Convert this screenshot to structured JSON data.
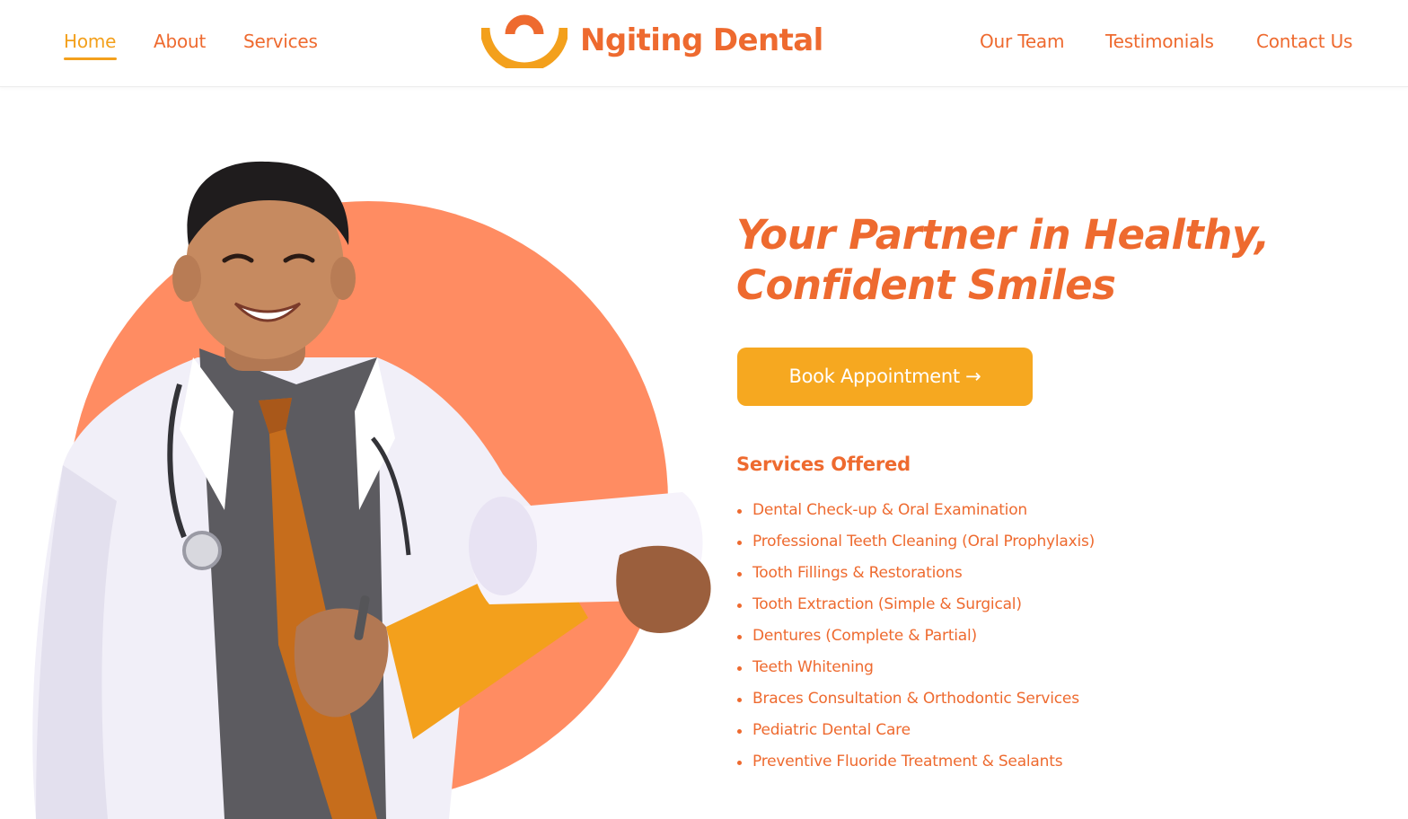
{
  "brand": {
    "name": "Ngiting Dental",
    "primary_color": "#ee6a2f",
    "accent_color": "#f3a01c",
    "circle_color": "#ff8c62"
  },
  "nav": {
    "left": [
      {
        "label": "Home",
        "active": true
      },
      {
        "label": "About",
        "active": false
      },
      {
        "label": "Services",
        "active": false
      }
    ],
    "right": [
      {
        "label": "Our Team"
      },
      {
        "label": "Testimonials"
      },
      {
        "label": "Contact Us"
      }
    ]
  },
  "hero": {
    "headline_line1": "Your Partner in Healthy,",
    "headline_line2": "Confident Smiles",
    "cta_label": "Book Appointment →",
    "image_subject": "smiling-dentist-with-clipboard"
  },
  "services": {
    "title": "Services Offered",
    "items": [
      "Dental Check-up & Oral Examination",
      "Professional Teeth Cleaning (Oral Prophylaxis)",
      "Tooth Fillings & Restorations",
      "Tooth Extraction (Simple & Surgical)",
      "Dentures (Complete & Partial)",
      "Teeth Whitening",
      "Braces Consultation & Orthodontic Services",
      "Pediatric Dental Care",
      "Preventive Fluoride Treatment & Sealants"
    ]
  }
}
